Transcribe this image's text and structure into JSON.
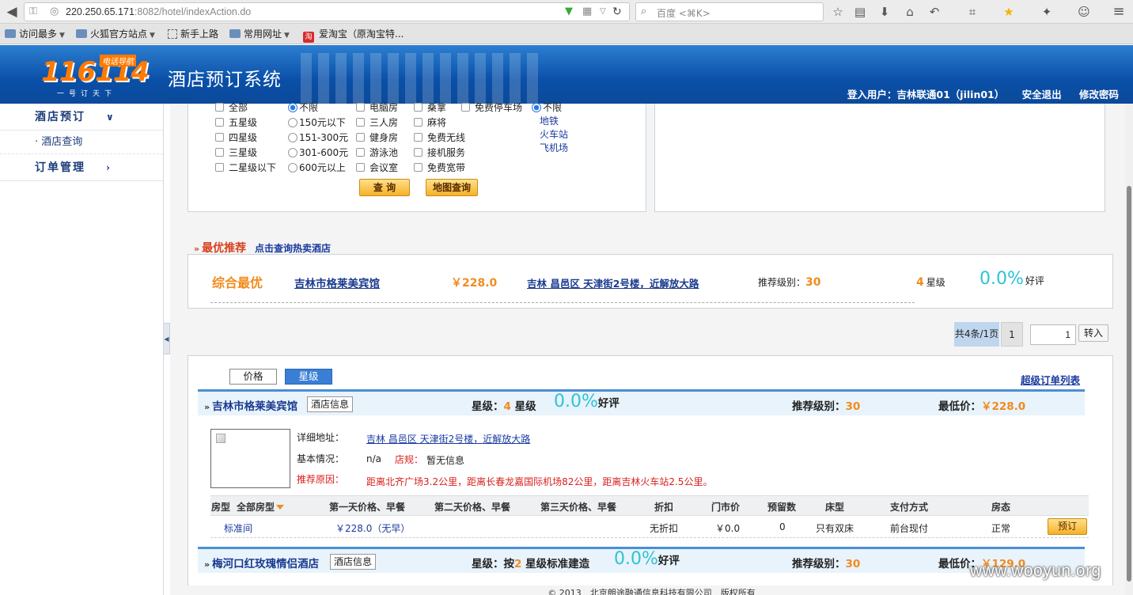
{
  "browser": {
    "url_host": "220.250.65.171",
    "url_path": ":8082/hotel/indexAction.do",
    "search_placeholder": "百度 <⌘K>",
    "bookmarks": [
      "访问最多",
      "火狐官方站点",
      "新手上路",
      "常用网址",
      "爱淘宝（原淘宝特..."
    ]
  },
  "header": {
    "logo_number": "116114",
    "logo_tag": "电话导航",
    "logo_slogan": "一号订天下",
    "system_title": "酒店预订系统",
    "user_info": "登入用户：吉林联通01（jilin01）",
    "logout": "安全退出",
    "change_password": "修改密码"
  },
  "sidebar": {
    "hotel_booking": "酒店预订",
    "hotel_query": "· 酒店查询",
    "order_manage": "订单管理"
  },
  "filters": {
    "stars": [
      "全部",
      "五星级",
      "四星级",
      "三星级",
      "二星级以下"
    ],
    "prices": [
      "不限",
      "150元以下",
      "151-300元",
      "301-600元",
      "600元以上"
    ],
    "facilities_a": [
      "电脑房",
      "三人房",
      "健身房",
      "游泳池",
      "会议室"
    ],
    "facilities_b": [
      "桑拿",
      "麻将",
      "免费无线",
      "接机服务",
      "免费宽带"
    ],
    "parking": "免费停车场",
    "location_default": "不限",
    "locations": [
      "地铁",
      "火车站",
      "飞机场"
    ],
    "query_btn": "查 询",
    "map_btn": "地图查询"
  },
  "recommend": {
    "title": "最优推荐",
    "hot_link": "点击查询热卖酒店",
    "best_label": "综合最优",
    "hotel_name": "吉林市格莱美宾馆",
    "price": "￥228.0",
    "address": "吉林 昌邑区 天津街2号楼，近解放大路",
    "level_label": "推荐级别：",
    "level": "30",
    "star_num": "4",
    "star_label": "星级",
    "rating": "0.0%",
    "rating_label": "好评"
  },
  "pager": {
    "total": "共4条/1页",
    "page": "1",
    "input_value": "1",
    "go": "转入"
  },
  "list": {
    "sort_price": "价格",
    "sort_star": "星级",
    "super_order_link": "超级订单列表",
    "hotel1": {
      "name": "吉林市格莱美宾馆",
      "info_btn": "酒店信息",
      "star_label": "星级：",
      "star_num": "4",
      "star_suffix": " 星级",
      "rating": "0.0%",
      "rating_label": "好评",
      "level_label": "推荐级别：",
      "level": "30",
      "low_label": "最低价：",
      "low_price": "￥228.0",
      "address_label": "详细地址：",
      "address": "吉林 昌邑区 天津街2号楼，近解放大路",
      "basic_label": "基本情况：",
      "basic": "n/a",
      "rule_label": "店规：",
      "rule": "暂无信息",
      "reason_label": "推荐原因：",
      "reason": "距离北齐广场3.2公里，距离长春龙嘉国际机场82公里，距离吉林火车站2.5公里。"
    },
    "table_headers": {
      "room": "房型",
      "all_rooms": "全部房型",
      "day1": "第一天价格、早餐",
      "day2": "第二天价格、早餐",
      "day3": "第三天价格、早餐",
      "discount": "折扣",
      "door_price": "门市价",
      "reserve": "预留数",
      "bed": "床型",
      "payment": "支付方式",
      "status": "房态"
    },
    "room_row": {
      "room": "标准间",
      "day1": "￥228.0（无早）",
      "discount": "无折扣",
      "door_price": "￥0.0",
      "reserve": "0",
      "bed": "只有双床",
      "payment": "前台现付",
      "status": "正常",
      "book_btn": "预订"
    },
    "hotel2": {
      "name": "梅河口红玫瑰情侣酒店",
      "info_btn": "酒店信息",
      "star_label": "星级：",
      "star_prefix": "按",
      "star_num": "2",
      "star_suffix": " 星级标准建造",
      "rating": "0.0%",
      "rating_label": "好评",
      "level_label": "推荐级别：",
      "level": "30",
      "low_label": "最低价：",
      "low_price": "￥129.0"
    }
  },
  "footer": "© 2013　北京朗途融通信息科技有限公司　版权所有",
  "watermark": "www.wooyun.org"
}
